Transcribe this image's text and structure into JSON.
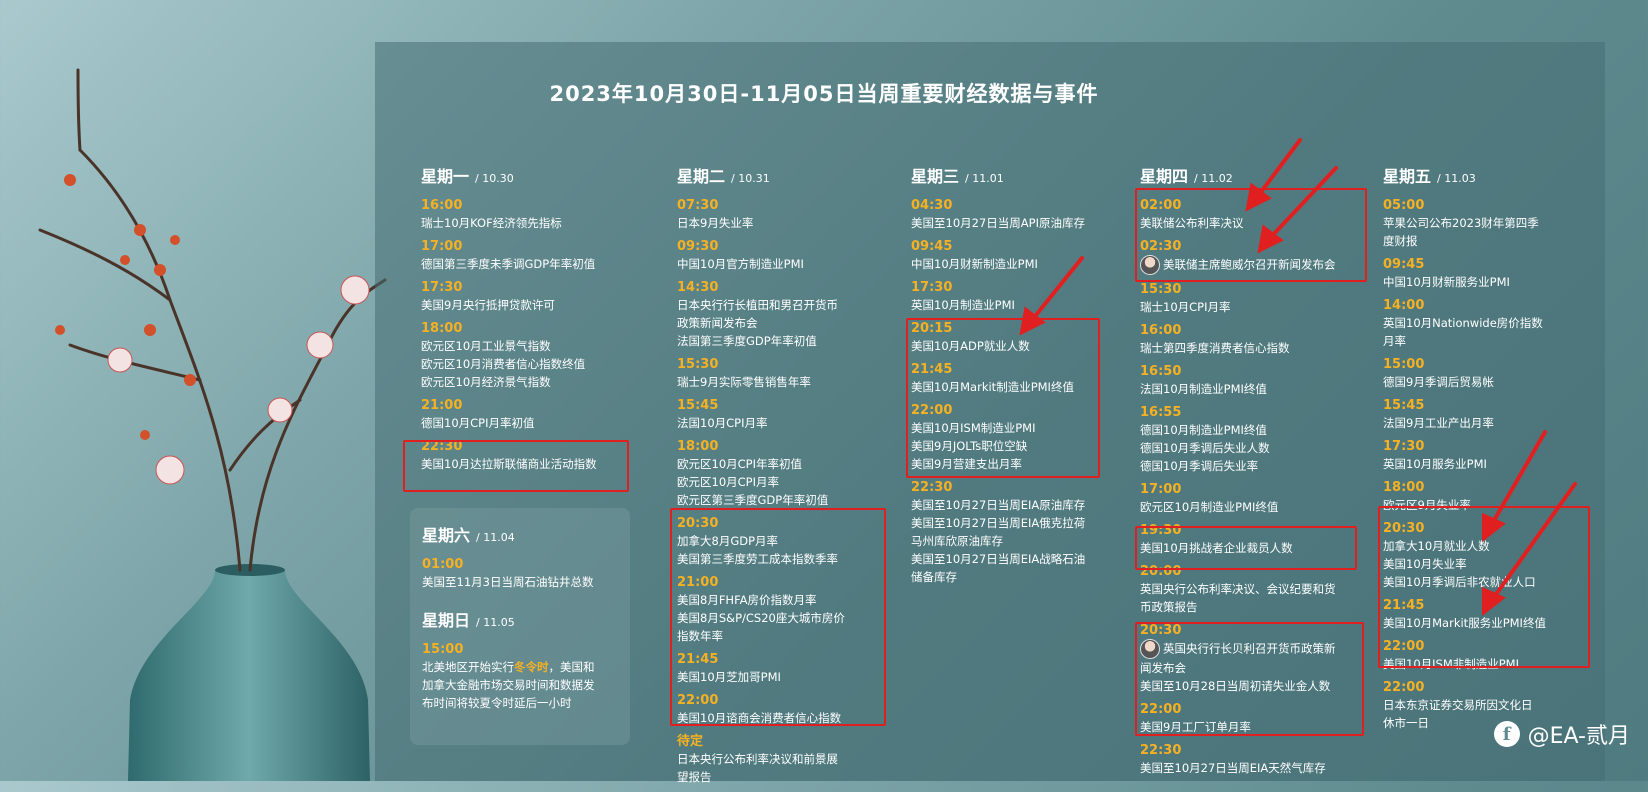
{
  "title": "2023年10月30日-11月05日当周重要财经数据与事件",
  "watermark": {
    "icon": "f",
    "text": "@EA-贰月"
  },
  "days": {
    "mon": {
      "name": "星期一",
      "date": "/ 10.30",
      "events": [
        {
          "time": "16:00",
          "items": [
            "瑞士10月KOF经济领先指标"
          ]
        },
        {
          "time": "17:00",
          "items": [
            "德国第三季度未季调GDP年率初值"
          ]
        },
        {
          "time": "17:30",
          "items": [
            "美国9月央行抵押贷款许可"
          ]
        },
        {
          "time": "18:00",
          "items": [
            "欧元区10月工业景气指数",
            "欧元区10月消费者信心指数终值",
            "欧元区10月经济景气指数"
          ]
        },
        {
          "time": "21:00",
          "items": [
            "德国10月CPI月率初值"
          ]
        },
        {
          "time": "22:30",
          "items": [
            "美国10月达拉斯联储商业活动指数"
          ]
        }
      ]
    },
    "tue": {
      "name": "星期二",
      "date": "/ 10.31",
      "events": [
        {
          "time": "07:30",
          "items": [
            "日本9月失业率"
          ]
        },
        {
          "time": "09:30",
          "items": [
            "中国10月官方制造业PMI"
          ]
        },
        {
          "time": "14:30",
          "items": [
            "日本央行行长植田和男召开货币",
            "政策新闻发布会",
            "法国第三季度GDP年率初值"
          ]
        },
        {
          "time": "15:30",
          "items": [
            "瑞士9月实际零售销售年率"
          ]
        },
        {
          "time": "15:45",
          "items": [
            "法国10月CPI月率"
          ]
        },
        {
          "time": "18:00",
          "items": [
            "欧元区10月CPI年率初值",
            "欧元区10月CPI月率",
            "欧元区第三季度GDP年率初值"
          ]
        },
        {
          "time": "20:30",
          "items": [
            "加拿大8月GDP月率",
            "美国第三季度劳工成本指数季率"
          ]
        },
        {
          "time": "21:00",
          "items": [
            "美国8月FHFA房价指数月率",
            "美国8月S&P/CS20座大城市房价",
            "指数年率"
          ]
        },
        {
          "time": "21:45",
          "items": [
            "美国10月芝加哥PMI"
          ]
        },
        {
          "time": "22:00",
          "items": [
            "美国10月谘商会消费者信心指数"
          ]
        },
        {
          "time": "待定",
          "items": [
            "日本央行公布利率决议和前景展",
            "望报告"
          ]
        }
      ]
    },
    "wed": {
      "name": "星期三",
      "date": "/ 11.01",
      "events": [
        {
          "time": "04:30",
          "items": [
            "美国至10月27日当周API原油库存"
          ]
        },
        {
          "time": "09:45",
          "items": [
            "中国10月财新制造业PMI"
          ]
        },
        {
          "time": "17:30",
          "items": [
            "英国10月制造业PMI"
          ]
        },
        {
          "time": "20:15",
          "items": [
            "美国10月ADP就业人数"
          ]
        },
        {
          "time": "21:45",
          "items": [
            "美国10月Markit制造业PMI终值"
          ]
        },
        {
          "time": "22:00",
          "items": [
            "美国10月ISM制造业PMI",
            "美国9月JOLTs职位空缺",
            "美国9月营建支出月率"
          ]
        },
        {
          "time": "22:30",
          "items": [
            "美国至10月27日当周EIA原油库存",
            "美国至10月27日当周EIA俄克拉荷",
            "马州库欣原油库存",
            "美国至10月27日当周EIA战略石油",
            "储备库存"
          ]
        }
      ]
    },
    "thu": {
      "name": "星期四",
      "date": "/ 11.02",
      "events": [
        {
          "time": "02:00",
          "items": [
            "美联储公布利率决议"
          ]
        },
        {
          "time": "02:30",
          "items": [
            "美联储主席鲍威尔召开新闻发布会"
          ]
        },
        {
          "time": "15:30",
          "items": [
            "瑞士10月CPI月率"
          ]
        },
        {
          "time": "16:00",
          "items": [
            "瑞士第四季度消费者信心指数"
          ]
        },
        {
          "time": "16:50",
          "items": [
            "法国10月制造业PMI终值"
          ]
        },
        {
          "time": "16:55",
          "items": [
            "德国10月制造业PMI终值",
            "德国10月季调后失业人数",
            "德国10月季调后失业率"
          ]
        },
        {
          "time": "17:00",
          "items": [
            "欧元区10月制造业PMI终值"
          ]
        },
        {
          "time": "19:30",
          "items": [
            "美国10月挑战者企业裁员人数"
          ]
        },
        {
          "time": "20:00",
          "items": [
            "英国央行公布利率决议、会议纪要和货",
            "币政策报告"
          ]
        },
        {
          "time": "20:30",
          "items": [
            "英国央行行长贝利召开货币政策新",
            "闻发布会",
            "美国至10月28日当周初请失业金人数"
          ]
        },
        {
          "time": "22:00",
          "items": [
            "美国9月工厂订单月率"
          ]
        },
        {
          "time": "22:30",
          "items": [
            "美国至10月27日当周EIA天然气库存"
          ]
        }
      ]
    },
    "fri": {
      "name": "星期五",
      "date": "/ 11.03",
      "events": [
        {
          "time": "05:00",
          "items": [
            "苹果公司公布2023财年第四季",
            "度财报"
          ]
        },
        {
          "time": "09:45",
          "items": [
            "中国10月财新服务业PMI"
          ]
        },
        {
          "time": "14:00",
          "items": [
            "英国10月Nationwide房价指数",
            "月率"
          ]
        },
        {
          "time": "15:00",
          "items": [
            "德国9月季调后贸易帐"
          ]
        },
        {
          "time": "15:45",
          "items": [
            "法国9月工业产出月率"
          ]
        },
        {
          "time": "17:30",
          "items": [
            "英国10月服务业PMI"
          ]
        },
        {
          "time": "18:00",
          "items": [
            "欧元区9月失业率"
          ]
        },
        {
          "time": "20:30",
          "items": [
            "加拿大10月就业人数",
            "美国10月失业率",
            "美国10月季调后非农就业人口"
          ]
        },
        {
          "time": "21:45",
          "items": [
            "美国10月Markit服务业PMI终值"
          ]
        },
        {
          "time": "22:00",
          "items": [
            "美国10月ISM非制造业PMI"
          ]
        },
        {
          "time": "22:00",
          "items": [
            "日本东京证券交易所因文化日",
            "休市一日"
          ]
        }
      ]
    },
    "sat": {
      "name": "星期六",
      "date": "/ 11.04",
      "events": [
        {
          "time": "01:00",
          "items": [
            "美国至11月3日当周石油钻井总数"
          ]
        }
      ]
    },
    "sun": {
      "name": "星期日",
      "date": "/ 11.05",
      "time": "15:00",
      "text_pre": "北美地区开始实行",
      "text_hl": "冬令时",
      "text_post_1": "，美国和",
      "text_post_2": "加拿大金融市场交易时间和数据发",
      "text_post_3": "布时间将较夏令时延后一小时"
    }
  }
}
